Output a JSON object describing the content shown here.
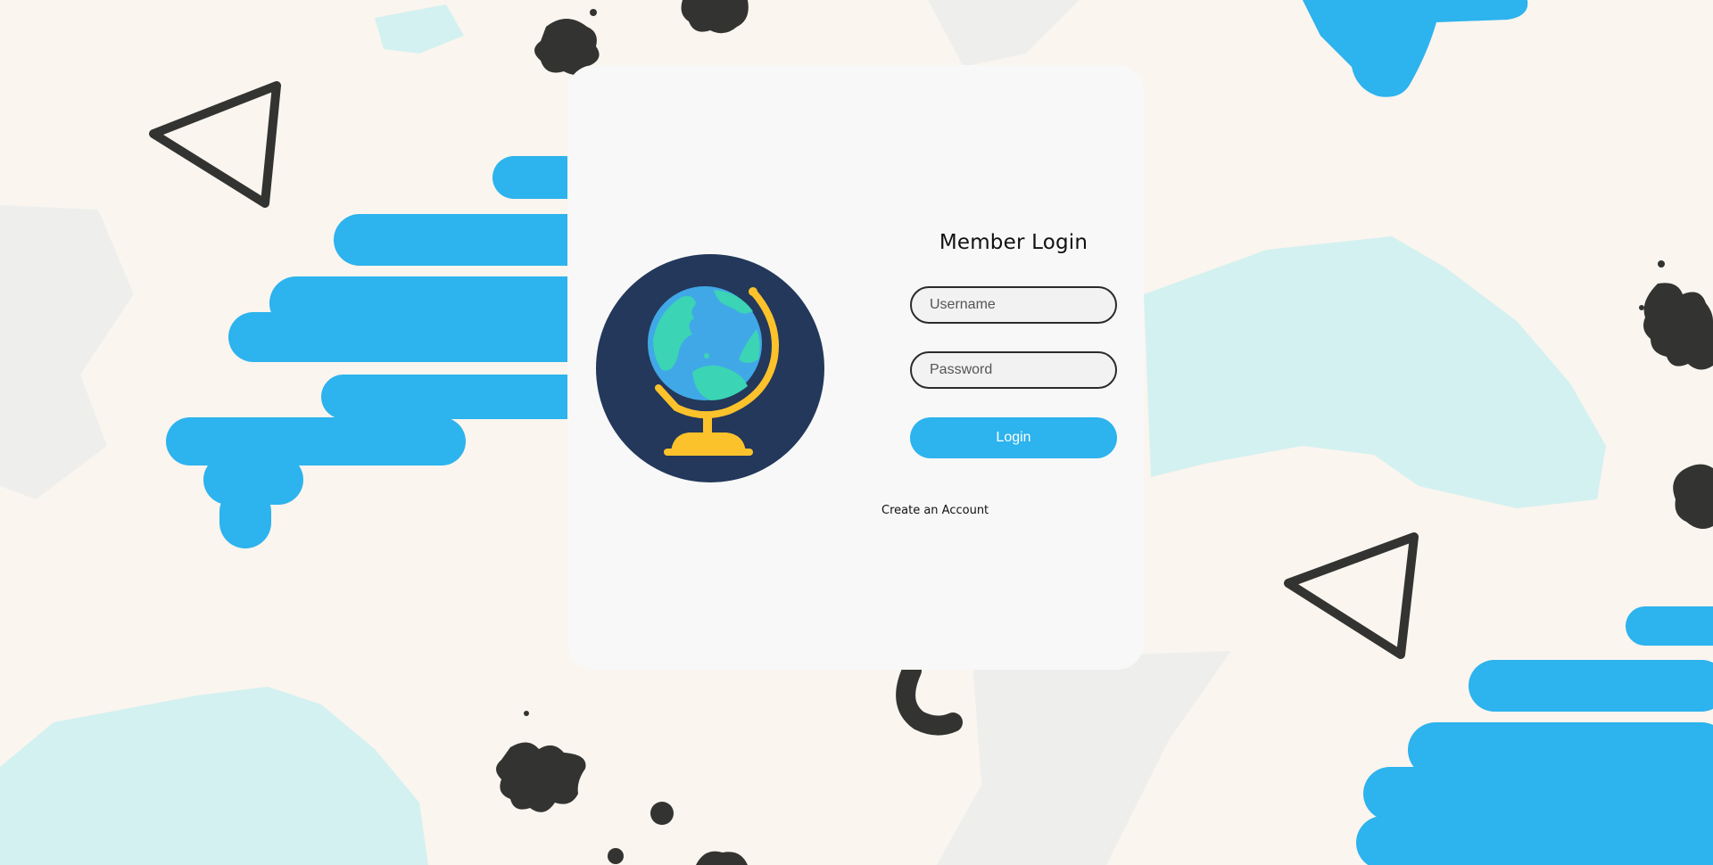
{
  "login": {
    "title": "Member Login",
    "username_placeholder": "Username",
    "password_placeholder": "Password",
    "username_value": "",
    "password_value": "",
    "submit_label": "Login",
    "create_account_label": "Create an Account"
  },
  "illustration": {
    "icon": "globe-icon"
  },
  "colors": {
    "page_background": "#faf5ef",
    "card_background": "#f8f8f8",
    "accent_blue": "#2db3ed",
    "light_cyan": "#d3f1f0",
    "ink": "#2f302d",
    "globe_circle": "#23385a",
    "globe_ocean": "#41a8e8",
    "globe_land": "#3bd4b4",
    "globe_stand": "#fbc22c"
  }
}
